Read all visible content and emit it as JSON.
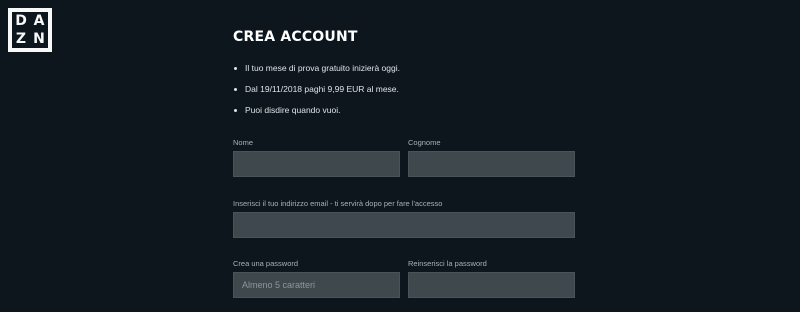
{
  "brand": {
    "logo_letters": [
      "D",
      "A",
      "Z",
      "N"
    ]
  },
  "form": {
    "title": "CREA ACCOUNT",
    "bullets": [
      "Il tuo mese di prova gratuito inizierà oggi.",
      "Dal 19/11/2018 paghi 9,99 EUR al mese.",
      "Puoi disdire quando vuoi."
    ],
    "fields": {
      "first_name": {
        "label": "Nome",
        "value": "",
        "placeholder": ""
      },
      "last_name": {
        "label": "Cognome",
        "value": "",
        "placeholder": ""
      },
      "email": {
        "label": "Inserisci il tuo indirizzo email - ti servirà dopo per fare l'accesso",
        "value": "",
        "placeholder": ""
      },
      "password": {
        "label": "Crea una password",
        "value": "",
        "placeholder": "Almeno 5 caratteri"
      },
      "password_confirm": {
        "label": "Reinserisci la password",
        "value": "",
        "placeholder": ""
      }
    }
  },
  "colors": {
    "background": "#0c161c",
    "input_background": "#3f484d",
    "text": "#ffffff",
    "label": "#a9b1b4"
  }
}
